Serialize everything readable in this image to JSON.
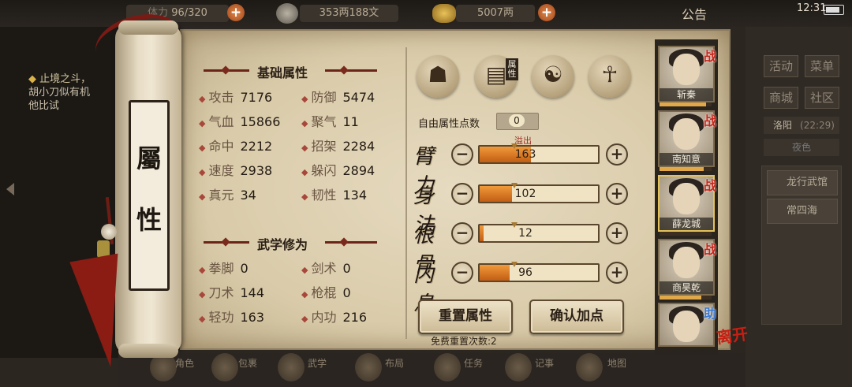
{
  "topbar": {
    "stamina": "96/320",
    "stamina_prefix": "体力",
    "silver": "353两188文",
    "gold": "5007两",
    "notice": "公告",
    "time": "12:31"
  },
  "quest": {
    "line1": "止境之斗",
    "line2": "胡小刀似有机",
    "line3": "他比试"
  },
  "right_panel": {
    "buttons": [
      "活动",
      "菜单",
      "商城",
      "社区"
    ],
    "city": "洛阳",
    "city_time": "(22:29)",
    "city2": "夜色",
    "locations": [
      "龙行武馆",
      "常四海"
    ]
  },
  "bottom_bar": [
    "角色",
    "包裹",
    "武学",
    "布局",
    "任务",
    "记事",
    "地图"
  ],
  "scroll": {
    "title_char1": "屬",
    "title_char2": "性"
  },
  "basic": {
    "title": "基础属性",
    "stats": [
      {
        "label": "攻击",
        "value": "7176"
      },
      {
        "label": "防御",
        "value": "5474"
      },
      {
        "label": "气血",
        "value": "15866"
      },
      {
        "label": "聚气",
        "value": "11"
      },
      {
        "label": "命中",
        "value": "2212"
      },
      {
        "label": "招架",
        "value": "2284"
      },
      {
        "label": "速度",
        "value": "2938"
      },
      {
        "label": "躲闪",
        "value": "2894"
      },
      {
        "label": "真元",
        "value": "34"
      },
      {
        "label": "韧性",
        "value": "134"
      }
    ]
  },
  "martial": {
    "title": "武学修为",
    "stats": [
      {
        "label": "拳脚",
        "value": "0"
      },
      {
        "label": "剑术",
        "value": "0"
      },
      {
        "label": "刀术",
        "value": "144"
      },
      {
        "label": "枪棍",
        "value": "0"
      },
      {
        "label": "轻功",
        "value": "163"
      },
      {
        "label": "内功",
        "value": "216"
      }
    ]
  },
  "icons": {
    "attr_tag": "属性"
  },
  "alloc": {
    "free_label": "自由属性点数",
    "free_points": "0",
    "overflow": "溢出",
    "rows": [
      {
        "label": "臂力",
        "value": "163",
        "fill": 0.43
      },
      {
        "label": "身法",
        "value": "102",
        "fill": 0.27
      },
      {
        "label": "根骨",
        "value": "12",
        "fill": 0.03
      },
      {
        "label": "内息",
        "value": "96",
        "fill": 0.25
      }
    ],
    "reset_button": "重置属性",
    "confirm_button": "确认加点",
    "free_reset": "免费重置次数:2"
  },
  "heroes": [
    {
      "name": "斩秦",
      "tag": "战",
      "bar": 0.9
    },
    {
      "name": "南知意",
      "tag": "战",
      "bar": 0.85
    },
    {
      "name": "薛龙城",
      "tag": "战",
      "bar": 0.0
    },
    {
      "name": "商昊乾",
      "tag": "战",
      "bar": 0.8
    },
    {
      "name": "",
      "tag": "助",
      "bar": 0.0
    }
  ],
  "leave_label": "离开",
  "colors": {
    "accent_red": "#a8483a",
    "bar_fill": "#e58a2a",
    "parchment": "#ddd0b2"
  }
}
